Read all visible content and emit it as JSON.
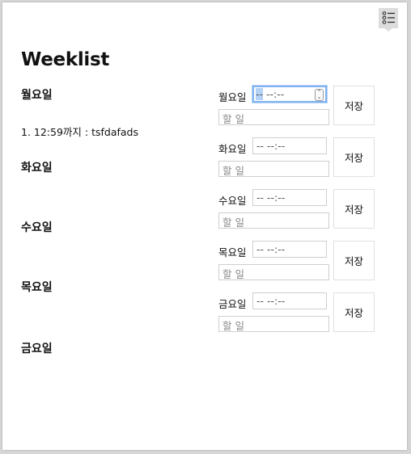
{
  "app": {
    "title": "Weeklist",
    "menu_icon": "checklist-icon"
  },
  "days": [
    {
      "heading": "월요일"
    },
    {
      "heading": "화요일"
    },
    {
      "heading": "수요일"
    },
    {
      "heading": "목요일"
    },
    {
      "heading": "금요일"
    }
  ],
  "entries": [
    {
      "text": "1. 12:59까지 : tsfdafads"
    }
  ],
  "forms": [
    {
      "label": "월요일",
      "time_hour": "--",
      "time_rest": " --:--",
      "task_placeholder": "할 일",
      "save_label": "저장",
      "focused": true
    },
    {
      "label": "화요일",
      "time_value": "-- --:--",
      "task_placeholder": "할 일",
      "save_label": "저장"
    },
    {
      "label": "수요일",
      "time_value": "-- --:--",
      "task_placeholder": "할 일",
      "save_label": "저장"
    },
    {
      "label": "목요일",
      "time_value": "-- --:--",
      "task_placeholder": "할 일",
      "save_label": "저장"
    },
    {
      "label": "금요일",
      "time_value": "-- --:--",
      "task_placeholder": "할 일",
      "save_label": "저장"
    }
  ],
  "colors": {
    "focus_ring": "#7fb2f0",
    "selection": "#b3d2f5"
  }
}
